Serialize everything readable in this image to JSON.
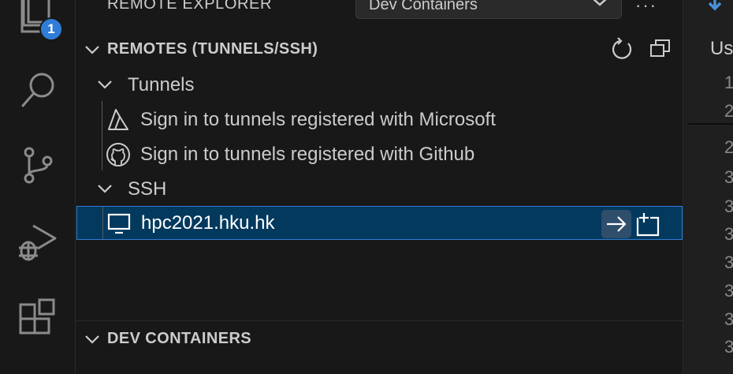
{
  "activity_bar": {
    "items": [
      {
        "name": "explorer",
        "icon": "files-icon"
      },
      {
        "name": "search",
        "icon": "search-icon"
      },
      {
        "name": "source-control",
        "icon": "source-control-icon"
      },
      {
        "name": "run-debug",
        "icon": "run-debug-icon"
      },
      {
        "name": "extensions",
        "icon": "extensions-icon"
      }
    ],
    "explorer_badge": "1"
  },
  "sidebar": {
    "title": "REMOTE EXPLORER",
    "remote_type_select": "Dev Containers",
    "more_actions": "···",
    "remotes_section": {
      "title": "REMOTES (TUNNELS/SSH)",
      "actions": [
        "refresh-icon",
        "new-window-icon"
      ]
    },
    "tunnels": {
      "label": "Tunnels",
      "items": [
        {
          "label": "Sign in to tunnels registered with Microsoft",
          "icon": "azure-icon"
        },
        {
          "label": "Sign in to tunnels registered with Github",
          "icon": "github-icon"
        }
      ]
    },
    "ssh": {
      "label": "SSH",
      "hosts": [
        {
          "label": "hpc2021.hku.hk",
          "icon": "monitor-icon",
          "selected": true,
          "actions": [
            "connect-current-window-icon",
            "connect-new-window-icon"
          ]
        }
      ]
    },
    "dev_containers_section": {
      "title": "DEV CONTAINERS"
    }
  },
  "editor": {
    "text": "Us",
    "line_numbers": [
      "1",
      "2",
      "2",
      "3",
      "3",
      "3",
      "3",
      "3",
      "3",
      "3"
    ]
  },
  "colors": {
    "background": "#181818",
    "selection": "#04395e",
    "focus_border": "#2f7dd6",
    "badge": "#2f7dd6",
    "text": "#cccccc"
  }
}
